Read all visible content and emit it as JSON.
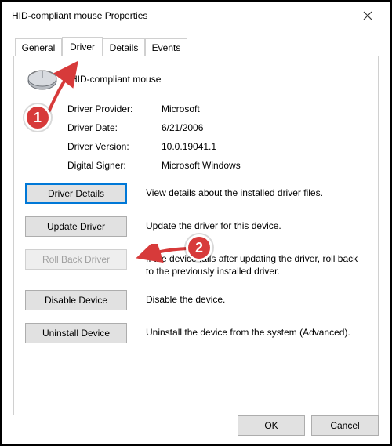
{
  "window": {
    "title": "HID-compliant mouse Properties"
  },
  "tabs": {
    "general": "General",
    "driver": "Driver",
    "details": "Details",
    "events": "Events"
  },
  "device": {
    "name": "HID-compliant mouse"
  },
  "info": {
    "provider_label": "Driver Provider:",
    "provider_value": "Microsoft",
    "date_label": "Driver Date:",
    "date_value": "6/21/2006",
    "version_label": "Driver Version:",
    "version_value": "10.0.19041.1",
    "signer_label": "Digital Signer:",
    "signer_value": "Microsoft Windows"
  },
  "actions": {
    "details_btn": "Driver Details",
    "details_desc": "View details about the installed driver files.",
    "update_btn": "Update Driver",
    "update_desc": "Update the driver for this device.",
    "rollback_btn": "Roll Back Driver",
    "rollback_desc": "If the device fails after updating the driver, roll back to the previously installed driver.",
    "disable_btn": "Disable Device",
    "disable_desc": "Disable the device.",
    "uninstall_btn": "Uninstall Device",
    "uninstall_desc": "Uninstall the device from the system (Advanced)."
  },
  "footer": {
    "ok": "OK",
    "cancel": "Cancel"
  },
  "annotations": {
    "badge1": "1",
    "badge2": "2"
  }
}
